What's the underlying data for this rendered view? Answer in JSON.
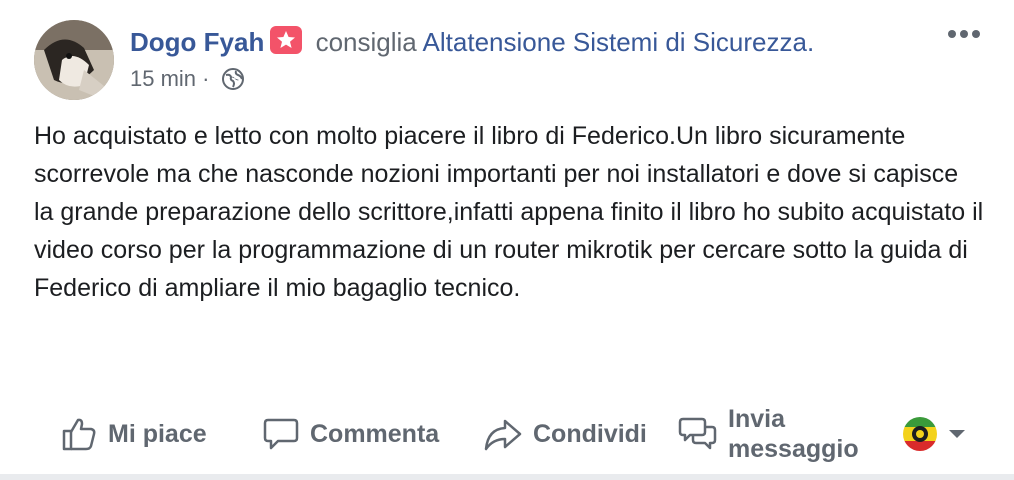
{
  "post": {
    "author": "Dogo Fyah",
    "verb": "consiglia",
    "page": "Altatensione Sistemi di Sicurezza.",
    "timestamp": "15 min",
    "separator": "·",
    "privacy_icon": "globe-icon",
    "badge_icon": "star-badge-icon",
    "more_icon": "more-options-icon",
    "text": "Ho acquistato e letto con molto piacere il libro di Federico.Un libro sicuramente scorrevole ma che nasconde nozioni importanti per noi installatori e dove si capisce la grande preparazione dello scrittore,infatti appena finito il libro ho subito acquistato il video corso per la programmazione di un router mikrotik per cercare sotto la guida di Federico di ampliare il mio bagaglio tecnico."
  },
  "actions": {
    "like": "Mi piace",
    "comment": "Commenta",
    "share": "Condividi",
    "send_line1": "Invia",
    "send_line2": "messaggio"
  },
  "colors": {
    "link": "#385898",
    "muted": "#606770",
    "text": "#1c1e21",
    "badge": "#f35369"
  }
}
